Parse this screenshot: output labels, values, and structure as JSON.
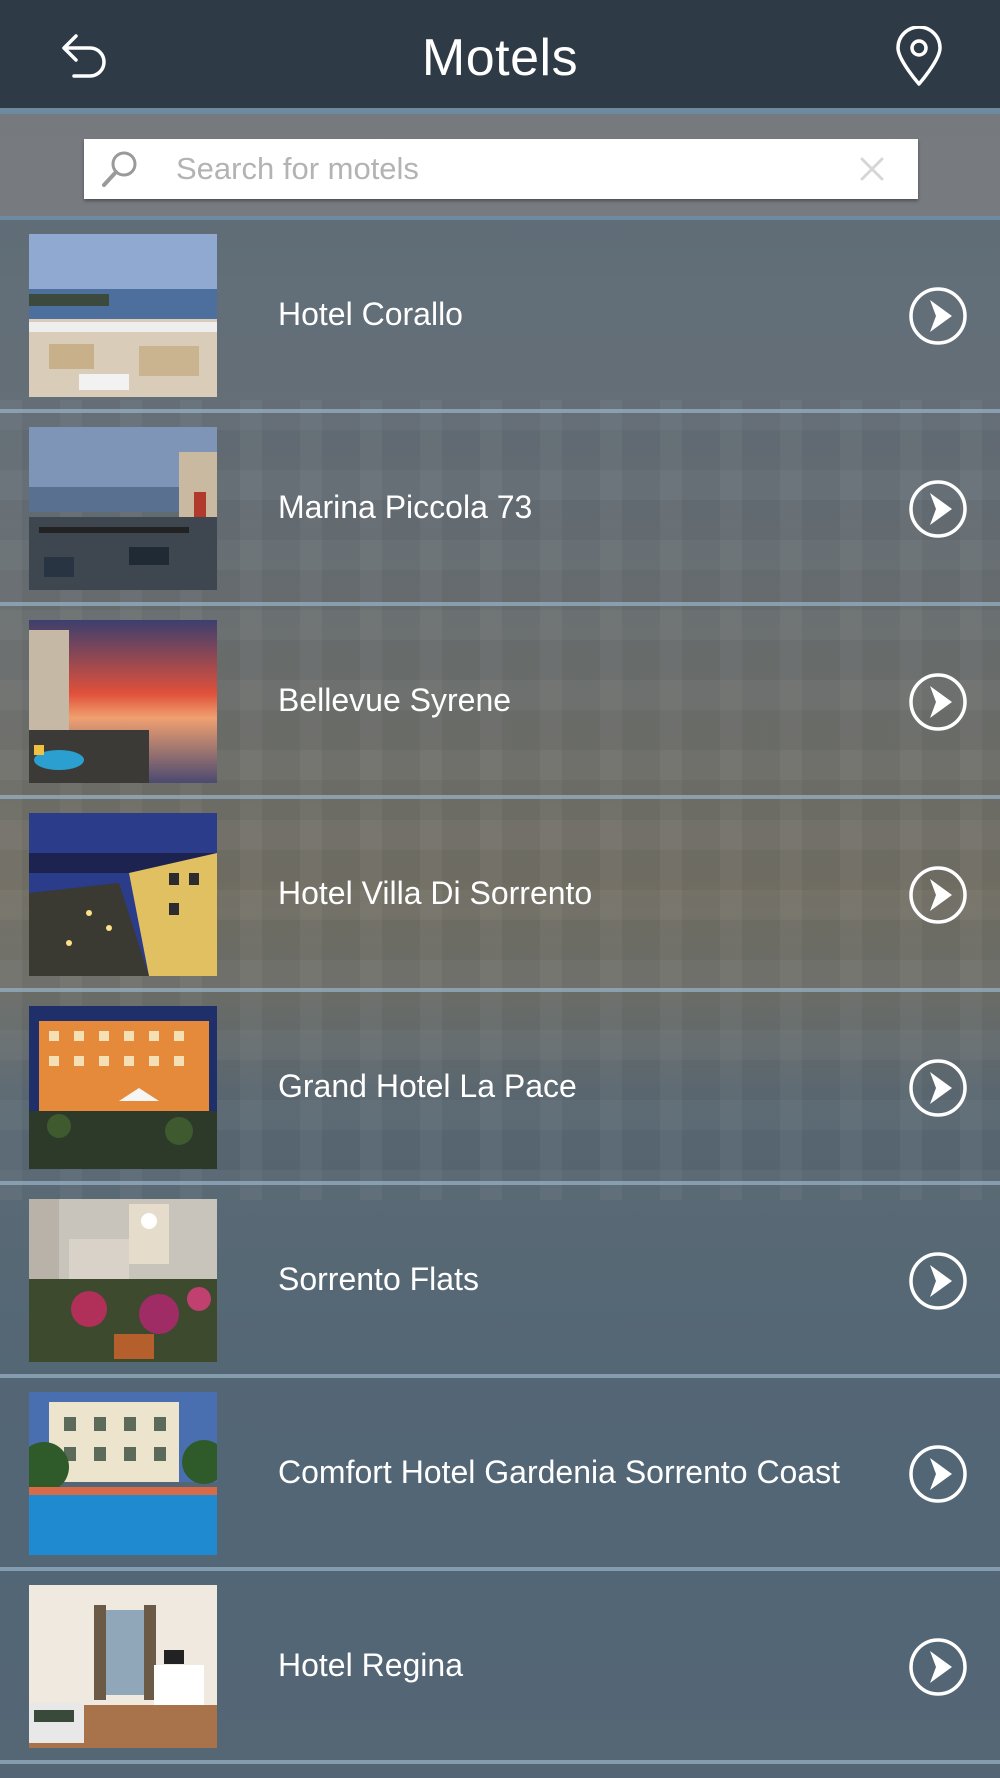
{
  "header": {
    "title": "Motels",
    "back_icon": "back-arrow-icon",
    "map_icon": "map-pin-icon"
  },
  "search": {
    "placeholder": "Search for motels",
    "value": ""
  },
  "colors": {
    "header_bg": "#2e3a45",
    "accent_line": "#6d8aa1",
    "text": "#ffffff"
  },
  "motels": [
    {
      "name": "Hotel Corallo",
      "thumb": "terrace-sea-view"
    },
    {
      "name": "Marina Piccola 73",
      "thumb": "balcony-harbour"
    },
    {
      "name": "Bellevue Syrene",
      "thumb": "sunset-cliff"
    },
    {
      "name": "Hotel Villa Di Sorrento",
      "thumb": "night-street"
    },
    {
      "name": "Grand Hotel La Pace",
      "thumb": "orange-hotel-facade"
    },
    {
      "name": "Sorrento Flats",
      "thumb": "flower-square"
    },
    {
      "name": "Comfort Hotel Gardenia Sorrento Coast",
      "thumb": "pool-garden"
    },
    {
      "name": "Hotel Regina",
      "thumb": "bedroom-interior"
    }
  ]
}
